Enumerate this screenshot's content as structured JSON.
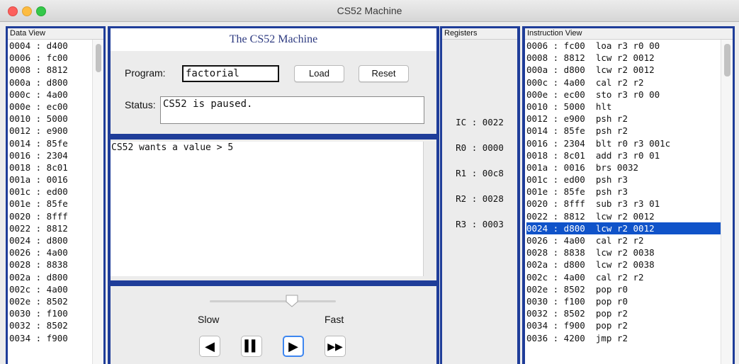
{
  "window": {
    "title": "CS52 Machine"
  },
  "data_view": {
    "header": "Data View",
    "rows": [
      "0004 : d400",
      "0006 : fc00",
      "0008 : 8812",
      "000a : d800",
      "000c : 4a00",
      "000e : ec00",
      "0010 : 5000",
      "0012 : e900",
      "0014 : 85fe",
      "0016 : 2304",
      "0018 : 8c01",
      "001a : 0016",
      "001c : ed00",
      "001e : 85fe",
      "0020 : 8fff",
      "0022 : 8812",
      "0024 : d800",
      "0026 : 4a00",
      "0028 : 8838",
      "002a : d800",
      "002c : 4a00",
      "002e : 8502",
      "0030 : f100",
      "0032 : 8502",
      "0034 : f900"
    ]
  },
  "machine": {
    "title": "The CS52 Machine",
    "program_label": "Program:",
    "program_value": "factorial",
    "load_label": "Load",
    "reset_label": "Reset",
    "status_label": "Status:",
    "status_value": "CS52 is paused."
  },
  "console": {
    "text": "CS52 wants a value > 5"
  },
  "speed": {
    "slow_label": "Slow",
    "fast_label": "Fast",
    "level": 0.65
  },
  "controls": {
    "back_icon": "step-back-icon",
    "pause_icon": "pause-icon",
    "play_icon": "play-icon",
    "fast_forward_icon": "fast-forward-icon"
  },
  "registers": {
    "header": "Registers",
    "items": [
      {
        "text": "IC : 0022"
      },
      {
        "text": "R0 : 0000"
      },
      {
        "text": "R1 : 00c8"
      },
      {
        "text": "R2 : 0028"
      },
      {
        "text": "R3 : 0003"
      }
    ]
  },
  "instruction_view": {
    "header": "Instruction View",
    "selected_index": 15,
    "rows": [
      "0006 : fc00  loa r3 r0 00",
      "0008 : 8812  lcw r2 0012",
      "000a : d800  lcw r2 0012",
      "000c : 4a00  cal r2 r2",
      "000e : ec00  sto r3 r0 00",
      "0010 : 5000  hlt",
      "0012 : e900  psh r2",
      "0014 : 85fe  psh r2",
      "0016 : 2304  blt r0 r3 001c",
      "0018 : 8c01  add r3 r0 01",
      "001a : 0016  brs 0032",
      "001c : ed00  psh r3",
      "001e : 85fe  psh r3",
      "0020 : 8fff  sub r3 r3 01",
      "0022 : 8812  lcw r2 0012",
      "0024 : d800  lcw r2 0012",
      "0026 : 4a00  cal r2 r2",
      "0028 : 8838  lcw r2 0038",
      "002a : d800  lcw r2 0038",
      "002c : 4a00  cal r2 r2",
      "002e : 8502  pop r0",
      "0030 : f100  pop r0",
      "0032 : 8502  pop r2",
      "0034 : f900  pop r2",
      "0036 : 4200  jmp r2"
    ]
  }
}
